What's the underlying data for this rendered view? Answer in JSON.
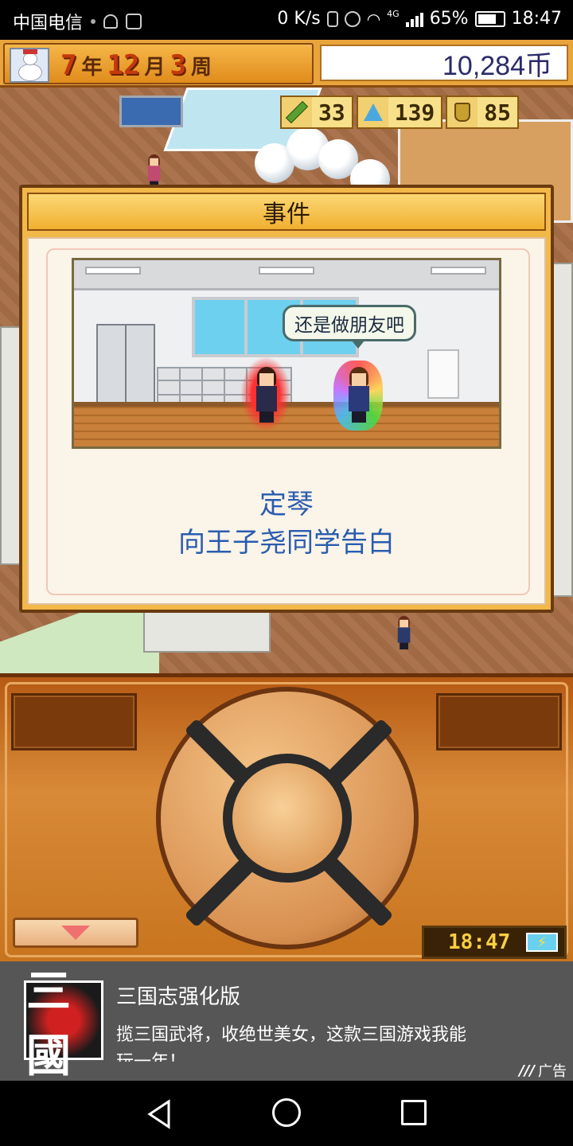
{
  "status_bar": {
    "carrier": "中国电信",
    "net_speed": "0 K/s",
    "network_type": "4G",
    "battery": "65%",
    "time": "18:47"
  },
  "hud": {
    "year": "7",
    "year_unit": "年",
    "month": "12",
    "month_unit": "月",
    "week": "3",
    "week_unit": "周",
    "money": "10,284币",
    "stats": [
      {
        "icon": "pencil-icon",
        "value": "33"
      },
      {
        "icon": "flask-icon",
        "value": "139"
      },
      {
        "icon": "trophy-icon",
        "value": "85"
      }
    ]
  },
  "dialog": {
    "title": "事件",
    "speech": "还是做朋友吧",
    "line1": "定琴",
    "line2": "向王子尧同学告白"
  },
  "controls": {
    "clock": "18:47"
  },
  "ad": {
    "logo_text": "三國",
    "title": "三国志强化版",
    "description": "揽三国武将，收绝世美女，这款三国游戏我能玩一年！",
    "tag": "广告"
  },
  "colors": {
    "hud_orange": "#e9a53c",
    "event_text_blue": "#2a5cb0",
    "panel_brown": "#c8741e",
    "ad_bg": "#565656"
  }
}
